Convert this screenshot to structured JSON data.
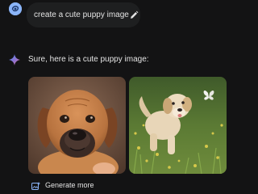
{
  "user_prompt": {
    "avatar_icon": "user-avatar-icon",
    "text": "create a cute puppy image",
    "edit_icon": "pencil-icon"
  },
  "response": {
    "icon": "gemini-sparkle-icon",
    "text": "Sure, here is a cute puppy image:",
    "images": [
      {
        "name": "brown-puppy-portrait-image"
      },
      {
        "name": "golden-puppy-running-in-grass-image"
      }
    ],
    "generate_more_label": "Generate more",
    "generate_more_icon": "image-plus-icon"
  },
  "colors": {
    "background": "#131314",
    "bubble": "#1e1f20",
    "accent_blue": "#8ab4f8",
    "sparkle_purple": "#9b72cb"
  }
}
